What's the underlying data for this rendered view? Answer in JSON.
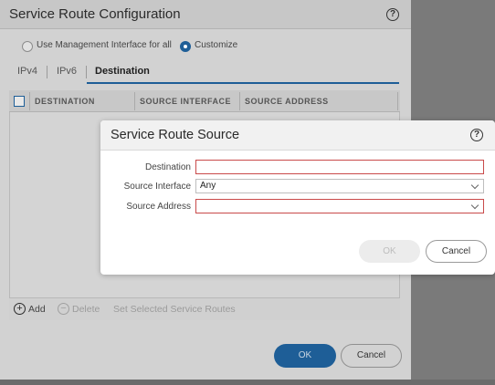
{
  "outer_dialog": {
    "title": "Service Route Configuration",
    "help": "?",
    "radio_mgmt_label": "Use Management Interface for all",
    "radio_custom_label": "Customize",
    "tabs": [
      "IPv4",
      "IPv6",
      "Destination"
    ],
    "active_tab": "Destination",
    "columns": [
      "DESTINATION",
      "SOURCE INTERFACE",
      "SOURCE ADDRESS"
    ],
    "add_label": "Add",
    "delete_label": "Delete",
    "set_selected_label": "Set Selected Service Routes",
    "ok_label": "OK",
    "cancel_label": "Cancel"
  },
  "modal": {
    "title": "Service Route Source",
    "help": "?",
    "destination_label": "Destination",
    "destination_value": "",
    "source_interface_label": "Source Interface",
    "source_interface_value": "Any",
    "source_address_label": "Source Address",
    "source_address_value": "",
    "ok_label": "OK",
    "cancel_label": "Cancel"
  },
  "colors": {
    "accent": "#1e5e97",
    "required_border": "#c94a4a",
    "overlay": "#7a7a7a"
  },
  "icons": [
    "help-icon",
    "radio-icon",
    "add-icon",
    "delete-icon",
    "chevron-down-icon"
  ]
}
